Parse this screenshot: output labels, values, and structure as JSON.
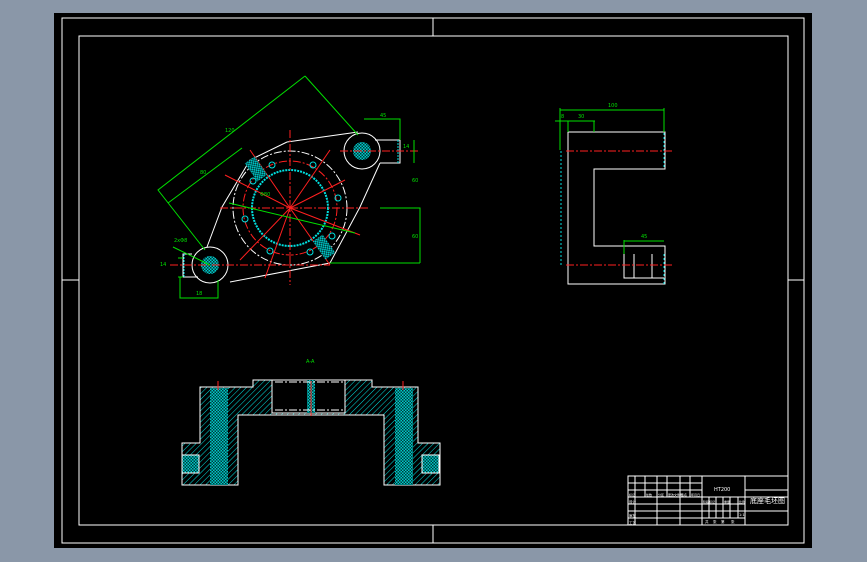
{
  "drawing": {
    "background_color": "#000000",
    "line_colors": {
      "outline": "#ffffff",
      "dimension": "#00e000",
      "centerline": "#ff2020",
      "hatch": "#00e0e0"
    },
    "top_view": {
      "dims": [
        "120",
        "80",
        "Φ80",
        "45",
        "14",
        "2xΦ8",
        "14",
        "60",
        "60",
        "18"
      ]
    },
    "side_view": {
      "dims": [
        "100",
        "8",
        "30",
        "45"
      ]
    },
    "section_view": {
      "label": "A-A"
    },
    "title_block": {
      "material": "HT200",
      "part_name": "底座毛坯图",
      "row_labels": [
        "标记",
        "处数",
        "分区",
        "更改文件号",
        "签名",
        "年月日"
      ],
      "designer_label": "设计",
      "checker_label": "审核",
      "process_label": "工艺",
      "stage_labels": [
        "阶段标记",
        "重量",
        "比例"
      ],
      "scale": "1:1",
      "sheet_labels": [
        "共",
        "张",
        "第",
        "张"
      ]
    }
  }
}
